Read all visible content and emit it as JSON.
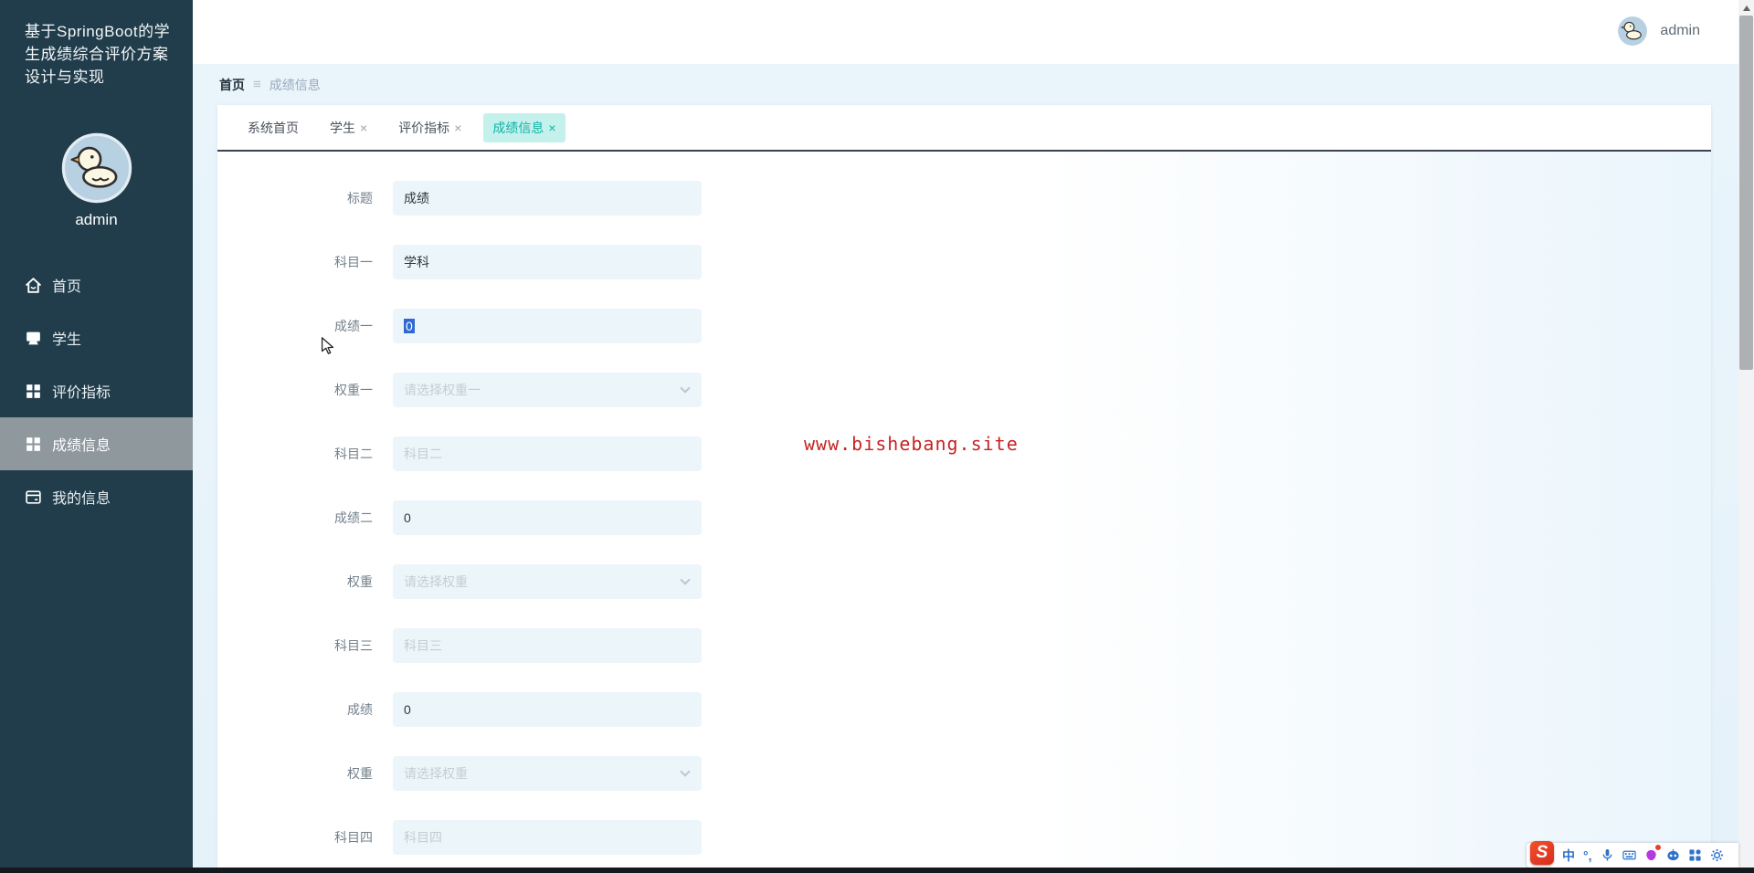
{
  "sidebar": {
    "title": "基于SpringBoot的学生成绩综合评价方案设计与实现",
    "username": "admin",
    "menu": [
      {
        "label": "首页",
        "icon": "home-icon"
      },
      {
        "label": "学生",
        "icon": "monitor-icon"
      },
      {
        "label": "评价指标",
        "icon": "grid-icon"
      },
      {
        "label": "成绩信息",
        "icon": "grid-icon",
        "active": true
      },
      {
        "label": "我的信息",
        "icon": "profile-card-icon"
      }
    ]
  },
  "header": {
    "username": "admin"
  },
  "breadcrumb": {
    "home": "首页",
    "separator": "≡",
    "current": "成绩信息"
  },
  "tabs": [
    {
      "label": "系统首页",
      "closable": false
    },
    {
      "label": "学生",
      "closable": true
    },
    {
      "label": "评价指标",
      "closable": true
    },
    {
      "label": "成绩信息",
      "closable": true,
      "active": true
    }
  ],
  "glyphs": {
    "close": "×"
  },
  "form": {
    "rows": [
      {
        "label": "标题",
        "type": "text",
        "value": "成绩"
      },
      {
        "label": "科目一",
        "type": "text",
        "value": "学科"
      },
      {
        "label": "成绩一",
        "type": "text",
        "value": "0",
        "state": "text-selected"
      },
      {
        "label": "权重一",
        "type": "select",
        "placeholder": "请选择权重一"
      },
      {
        "label": "科目二",
        "type": "text",
        "placeholder": "科目二"
      },
      {
        "label": "成绩二",
        "type": "text",
        "value": "0"
      },
      {
        "label": "权重",
        "type": "select",
        "placeholder": "请选择权重"
      },
      {
        "label": "科目三",
        "type": "text",
        "placeholder": "科目三"
      },
      {
        "label": "成绩",
        "type": "text",
        "value": "0"
      },
      {
        "label": "权重",
        "type": "select",
        "placeholder": "请选择权重"
      },
      {
        "label": "科目四",
        "type": "text",
        "placeholder": "科目四"
      }
    ]
  },
  "watermark": {
    "text": "www.bishebang.site",
    "color": "#c62424"
  },
  "ime_toolbar": {
    "logo": "S",
    "mode": "中",
    "punct": "°,",
    "icons": [
      "sogou-logo-icon",
      "chinese-mode-icon",
      "punctuation-icon",
      "microphone-icon",
      "keyboard-icon",
      "skin-icon",
      "smart-assistant-icon",
      "toolbox-icon",
      "settings-icon"
    ]
  },
  "colors": {
    "sidebar_bg": "#213d4b",
    "sidebar_active_bg": "#8e989d",
    "active_tab_bg": "#c5f1ec",
    "active_tab_text": "#0fb3a9",
    "input_bg": "#ecf5fa",
    "selection_blue": "#2e6ad1",
    "watermark_red": "#c62424",
    "ime_red": "#e03a22",
    "ime_blue": "#2f73c9"
  }
}
